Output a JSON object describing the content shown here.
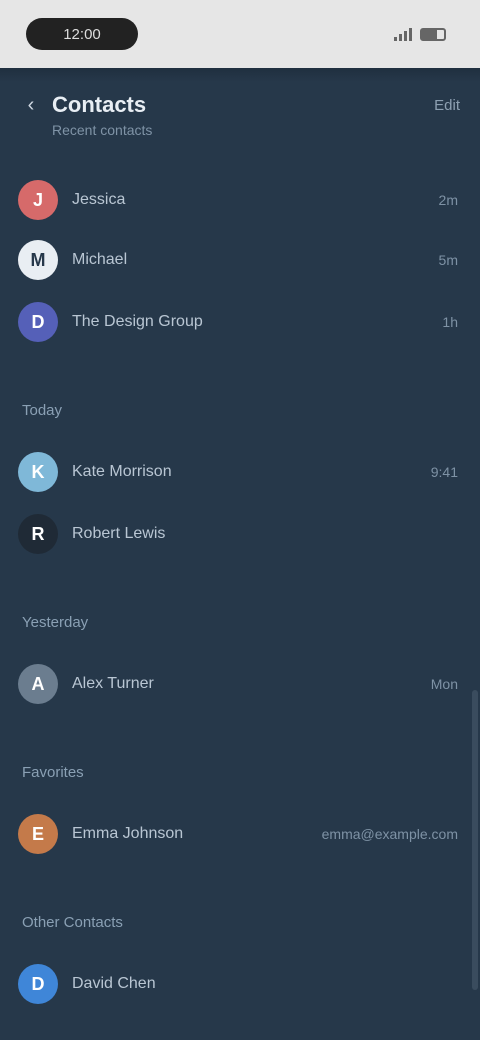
{
  "status_bar": {
    "time": "12:00"
  },
  "header": {
    "title": "Contacts",
    "subtitle": "Recent contacts",
    "action": "Edit"
  },
  "sections": [
    {
      "label": "",
      "items": [
        {
          "name": "Jessica",
          "value": "2m",
          "avatar_color": "#d66a6a",
          "initial": "J"
        },
        {
          "name": "Michael",
          "value": "5m",
          "avatar_color": "#e9eef3",
          "initial": "M"
        },
        {
          "name": "The Design Group",
          "value": "1h",
          "avatar_color": "#5560b8",
          "initial": "D"
        }
      ]
    },
    {
      "label": "Today",
      "items": [
        {
          "name": "Kate Morrison",
          "value": "9:41",
          "avatar_color": "#7fb8d8",
          "initial": "K"
        },
        {
          "name": "Robert Lewis",
          "value": "",
          "avatar_color": "#1f2a36",
          "initial": "R"
        }
      ]
    },
    {
      "label": "Yesterday",
      "items": [
        {
          "name": "Alex Turner",
          "value": "Mon",
          "avatar_color": "#6b7d8f",
          "initial": "A"
        }
      ]
    },
    {
      "label": "Favorites",
      "items": [
        {
          "name": "Emma Johnson",
          "value": "emma@example.com",
          "avatar_color": "#c47a4a",
          "initial": "E"
        }
      ]
    },
    {
      "label": "Other Contacts",
      "items": [
        {
          "name": "David Chen",
          "value": "",
          "avatar_color": "#3f86d8",
          "initial": "D"
        }
      ]
    }
  ]
}
